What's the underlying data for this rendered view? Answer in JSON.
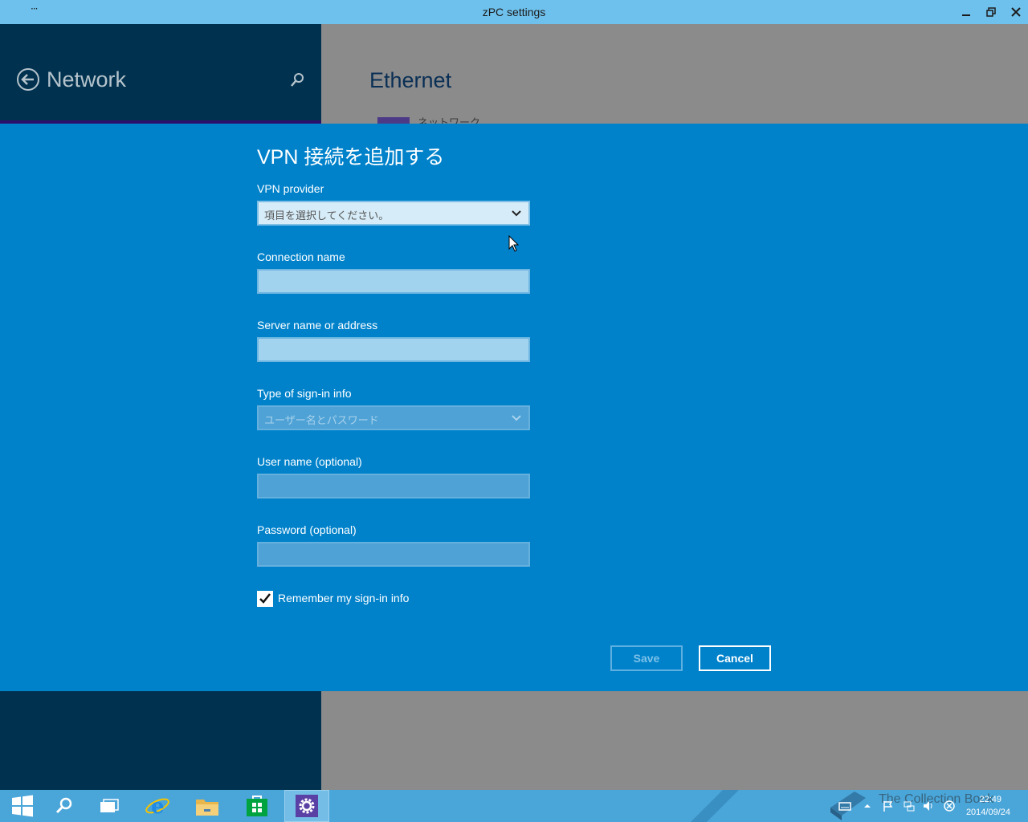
{
  "window": {
    "title": "zPC settings",
    "menu_glyph": "···"
  },
  "nav": {
    "title": "Network",
    "back_icon": "back-arrow-icon",
    "search_icon": "search-icon"
  },
  "content": {
    "title": "Ethernet",
    "tile_label": "ネットワーク"
  },
  "dialog": {
    "title": "VPN 接続を追加する",
    "fields": {
      "vpn_provider": {
        "label": "VPN provider",
        "value": "項目を選択してください。"
      },
      "connection_name": {
        "label": "Connection name",
        "value": ""
      },
      "server": {
        "label": "Server name or address",
        "value": ""
      },
      "signin_type": {
        "label": "Type of sign-in info",
        "value": "ユーザー名とパスワード"
      },
      "username": {
        "label": "User name (optional)",
        "value": ""
      },
      "password": {
        "label": "Password (optional)",
        "value": ""
      }
    },
    "remember": {
      "label": "Remember my sign-in info",
      "checked": true
    },
    "buttons": {
      "save": "Save",
      "cancel": "Cancel"
    }
  },
  "taskbar": {
    "items": [
      "start-icon",
      "search-icon",
      "task-view-icon",
      "internet-explorer-icon",
      "file-explorer-icon",
      "store-icon",
      "settings-icon"
    ],
    "clock_time": "22:49",
    "clock_date": "2014/09/24",
    "watermark": "The Collection Book"
  },
  "colors": {
    "dialog_bg": "#0082cb",
    "titlebar_bg": "#6fc1ed",
    "nav_bg": "#00324f",
    "taskbar_bg": "#4aa5d9"
  }
}
